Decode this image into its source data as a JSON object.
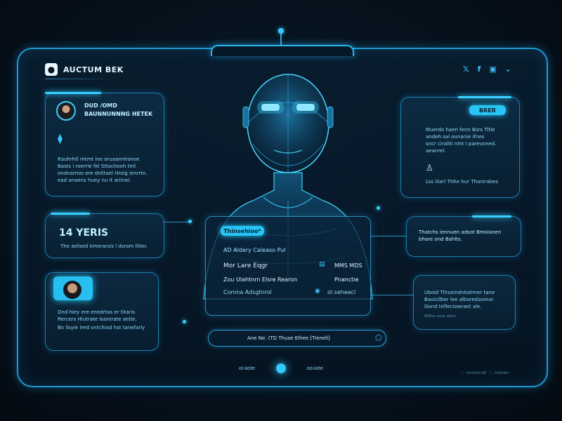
{
  "brand": {
    "name": "AUCTUM BEK",
    "icon": "person-badge-icon"
  },
  "social": {
    "items": [
      "𝕏",
      "f",
      "▣",
      "⌄"
    ]
  },
  "profile_card": {
    "title": "DUD /OMD",
    "subtitle": "BAUNNUNNNG HETEK",
    "lines": [
      "Rauhrhtl mtmt ine oruaanmisnoe",
      "Basts i roerrie fel Sttachooh tml",
      "ondnarnos ere dnlitael Hroig ienrrtn.",
      "ead anaens huey nu it ariinel."
    ]
  },
  "years_card": {
    "value": "14 YERIS",
    "caption": "The aefaed kmerarsis l dsrom lliter."
  },
  "contact_card": {
    "lines": [
      "Dnd hiey ere enedrtas er titaris",
      "Rercers Hlutrate Isarorate aetie.",
      "Bo llsyie lred ontchiad hst tanefarly"
    ]
  },
  "right_top_card": {
    "button": "BRER",
    "lines": [
      "Muerdo haen fenn Bsrs Tltle",
      "andeh sal ounanie ifnes",
      "sncr ciraliti nlnt I parevoned.",
      "aeanrel."
    ],
    "footer": "Lss liiarl Thhe hur Thanirabes"
  },
  "right_mid_card": {
    "lines": [
      "Thatchs iennuen adsot Bmolanen",
      "bhare ond Bahlts."
    ]
  },
  "right_low_card": {
    "lines": [
      "Uboid Tllrosindntiotmer tane",
      "Baoicllber lee alboredsoreur",
      "Gond tefleciowraet ale."
    ],
    "footer": "Wlilhe seiue alelis."
  },
  "center_panel": {
    "tag": "Thinsehioo*",
    "heading": "AD Aldery Caleaso Pul",
    "rows": [
      {
        "left": "Mor Lare Eqgr",
        "right": "MMS MDS"
      },
      {
        "left": "Zou Ulahtnrn Elsre Rearon",
        "right": "Pnanctie"
      },
      {
        "left": "Comna Adsgtnrol",
        "right": "ol seheacl"
      }
    ]
  },
  "search": {
    "text": "Ane Ne. (TD Thuse Elhee [Tienell]"
  },
  "bottom": {
    "left": "oi oote",
    "right": "oo iote"
  },
  "footer_right": "◌   sooeeceb   ◌   ooieee",
  "colors": {
    "accent": "#27c4f5",
    "frame": "#1d9bd6",
    "bg": "#06121d"
  }
}
